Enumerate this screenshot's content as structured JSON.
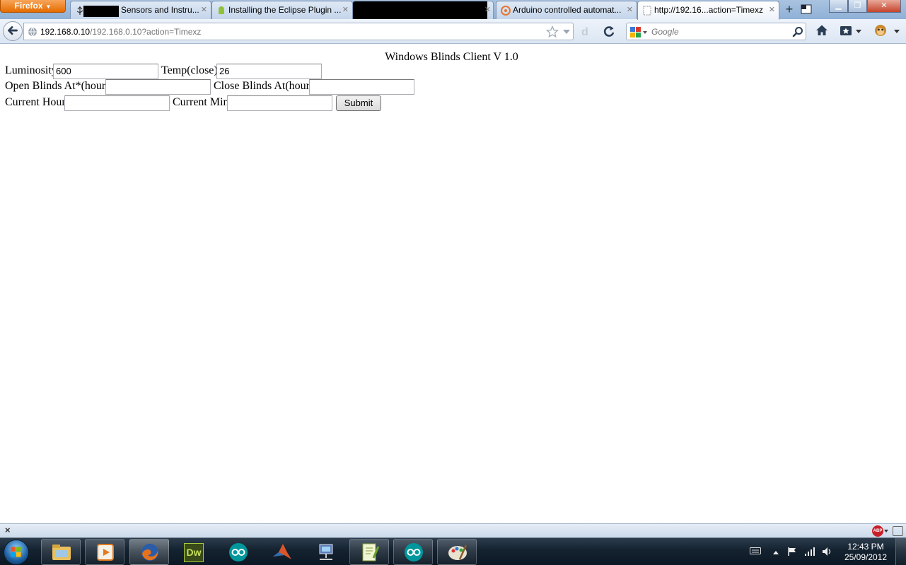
{
  "browser": {
    "menu_button_label": "Firefox",
    "tabs": [
      {
        "title": "Sensors and Instru...",
        "icon": "usb-icon",
        "redacted": true
      },
      {
        "title": "Installing the Eclipse Plugin ...",
        "icon": "android-icon"
      },
      {
        "title": "",
        "icon": "",
        "redacted": true
      },
      {
        "title": "Arduino controlled automat...",
        "icon": "instructables-icon"
      },
      {
        "title": "http://192.16...action=Timexz",
        "icon": "blank-page-icon",
        "active": true
      }
    ],
    "new_tab_label": "+",
    "url_host": "192.168.0.10",
    "url_rest": "/192.168.0.10?action=Timexz",
    "search_placeholder": "Google"
  },
  "page": {
    "title": "Windows Blinds Client V 1.0",
    "fields": {
      "luminosity_label": "Luminosity:",
      "luminosity_value": "600",
      "temp_label": "Temp(close):",
      "temp_value": "26",
      "open_label": "Open Blinds At*(hour):",
      "open_value": "",
      "close_label": "Close Blinds At(hour):",
      "close_value": "",
      "hour_label": "Current Hour:",
      "hour_value": "",
      "min_label": "Current Min:",
      "min_value": ""
    },
    "submit_label": "Submit"
  },
  "addon_bar": {
    "close_label": "×",
    "adblock_label": "ABP"
  },
  "taskbar": {
    "apps": [
      "windows-explorer-icon",
      "media-player-icon",
      "firefox-icon",
      "dreamweaver-icon",
      "arduino-icon",
      "matlab-icon",
      "network-icon",
      "editor-icon",
      "arduino-icon",
      "paint-icon"
    ],
    "dreamweaver_label": "Dw",
    "clock_time": "12:43 PM",
    "clock_date": "25/09/2012"
  },
  "colors": {
    "accent_firefox": "#e66b00",
    "tab_strip": "#a9c3e0",
    "taskbar": "#142230"
  }
}
